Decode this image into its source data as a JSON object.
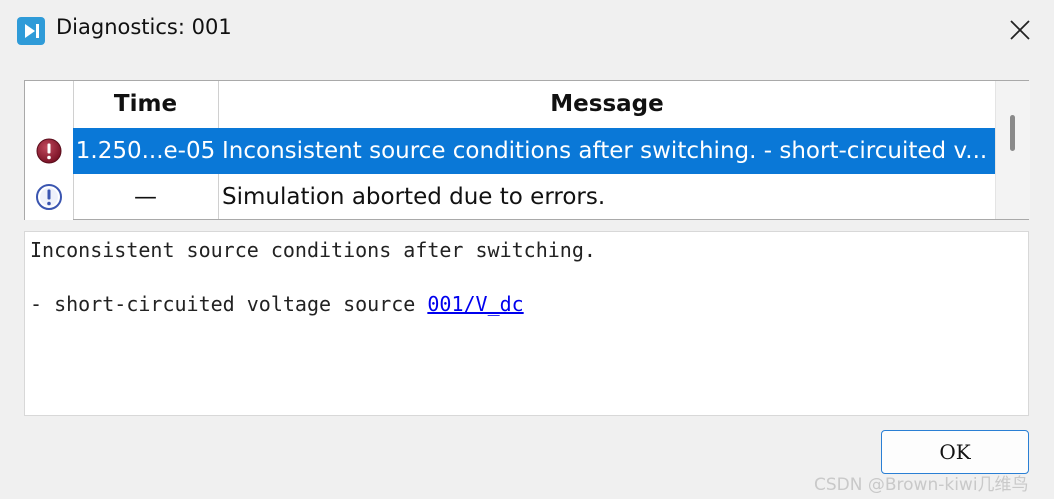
{
  "window": {
    "title": "Diagnostics: 001",
    "app_icon": "play-next-icon",
    "close_icon": "close-icon"
  },
  "table": {
    "columns": [
      "",
      "Time",
      "Message"
    ],
    "rows": [
      {
        "severity_icon": "error-icon",
        "time": "1.250...e-05",
        "message": "Inconsistent source conditions after switching.  - short-circuited v...",
        "selected": true
      },
      {
        "severity_icon": "info-icon",
        "time": "—",
        "message": "Simulation aborted due to errors.",
        "selected": false
      }
    ]
  },
  "details": {
    "line1": "Inconsistent source conditions after switching.",
    "line2_prefix": "- short-circuited voltage source ",
    "line2_link": "001/V_dc"
  },
  "buttons": {
    "ok": "OK"
  },
  "watermark": "CSDN @Brown-kiwi几维鸟",
  "colors": {
    "selection": "#0a78d7",
    "error": "#8b1b2f",
    "info": "#3a55b0",
    "link": "#0000ee"
  }
}
